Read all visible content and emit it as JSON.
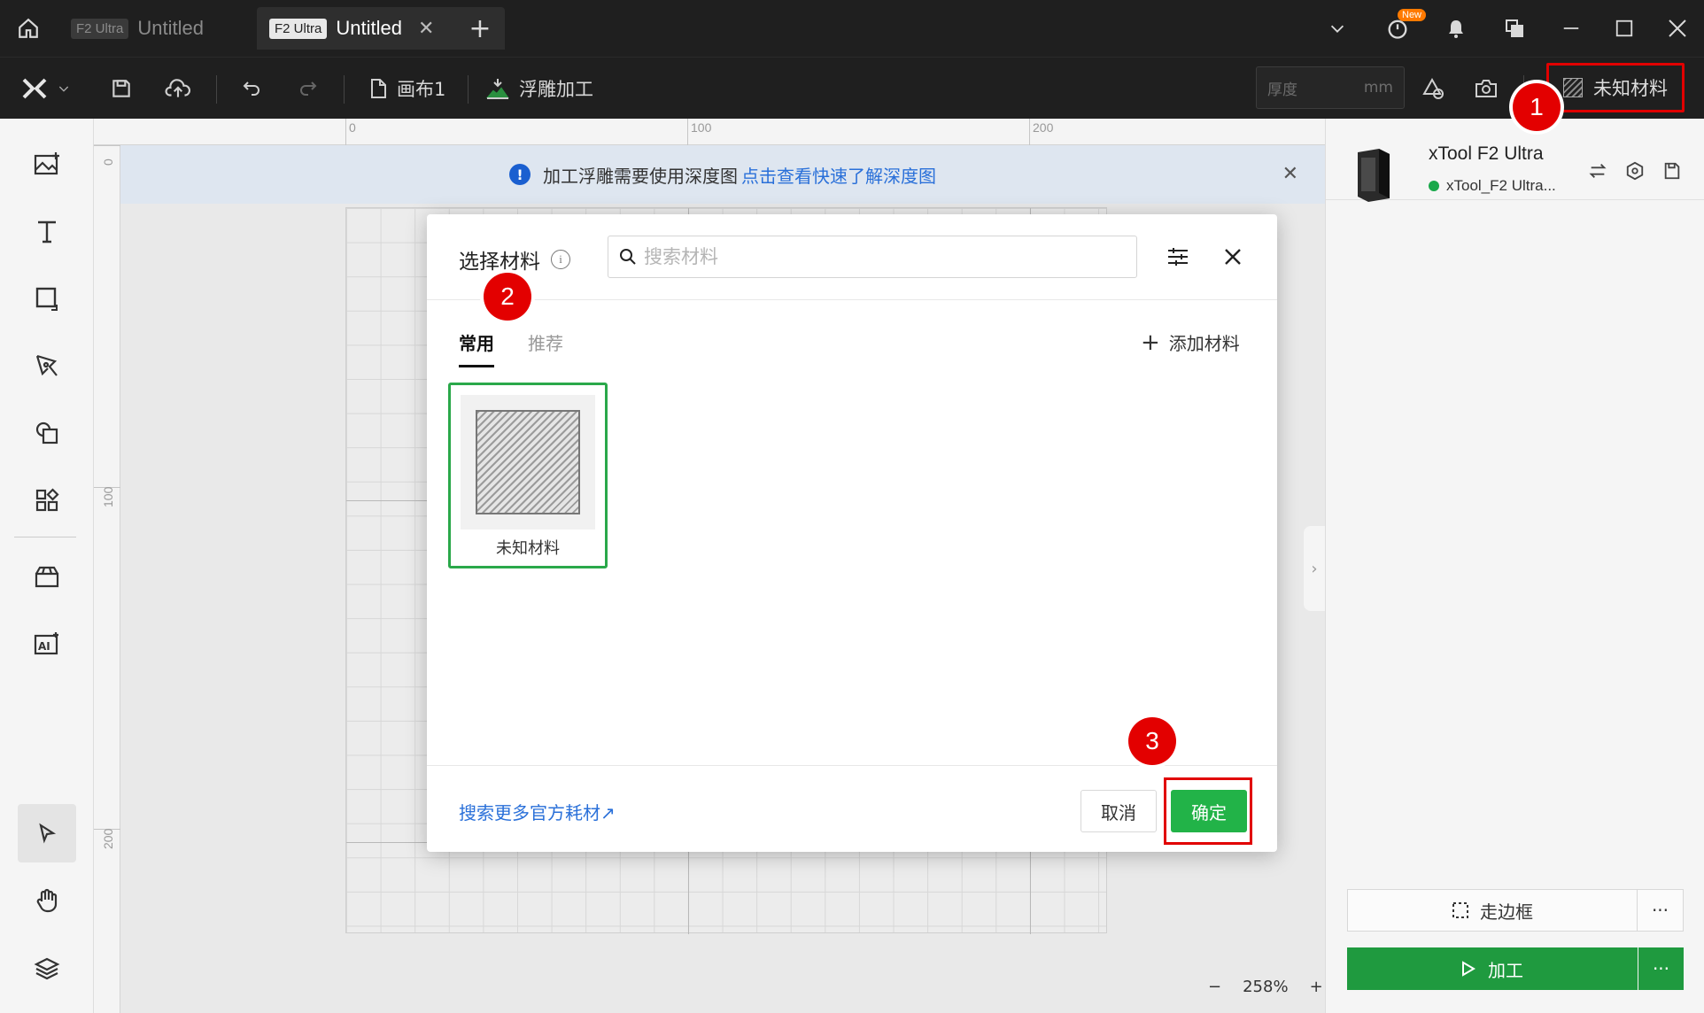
{
  "titlebar": {
    "tabs": [
      {
        "badge": "F2 Ultra",
        "name": "Untitled",
        "active": false
      },
      {
        "badge": "F2 Ultra",
        "name": "Untitled",
        "active": true
      }
    ],
    "close_glyph": "✕",
    "add_glyph": "+",
    "new_badge": "New",
    "icons": [
      "home-icon",
      "chevron-down-icon",
      "timer-icon",
      "bell-icon",
      "windows-icon",
      "minimize-icon",
      "maximize-icon",
      "close-icon"
    ]
  },
  "toolbar": {
    "canvas_label": "画布1",
    "mode_label": "浮雕加工",
    "thickness_placeholder": "厚度",
    "thickness_unit": "mm",
    "material_label": "未知材料"
  },
  "banner": {
    "text": "加工浮雕需要使用深度图",
    "link": "点击查看快速了解深度图",
    "info_glyph": "!",
    "close_glyph": "✕"
  },
  "ruler": {
    "top_labels": [
      "0",
      "100",
      "200"
    ],
    "left_labels": [
      "0",
      "100",
      "200"
    ]
  },
  "zoom": {
    "level": "258%",
    "minus": "−",
    "plus": "+"
  },
  "device": {
    "name": "xTool F2 Ultra",
    "connection": "xTool_F2 Ultra..."
  },
  "actions": {
    "frame_label": "走边框",
    "process_label": "加工",
    "more_glyph": "···"
  },
  "dialog": {
    "title": "选择材料",
    "info_glyph": "i",
    "search_placeholder": "搜索材料",
    "tabs": [
      "常用",
      "推荐"
    ],
    "add_material": "添加材料",
    "add_glyph": "+",
    "materials": [
      {
        "name": "未知材料",
        "selected": true
      }
    ],
    "more_link": "搜索更多官方耗材↗",
    "cancel_label": "取消",
    "ok_label": "确定"
  },
  "steps": [
    "1",
    "2",
    "3"
  ],
  "colors": {
    "dark_bar": "#1f1f1f",
    "accent_green": "#22b348",
    "link_blue": "#2a70d9",
    "highlight_red": "#e10000"
  }
}
